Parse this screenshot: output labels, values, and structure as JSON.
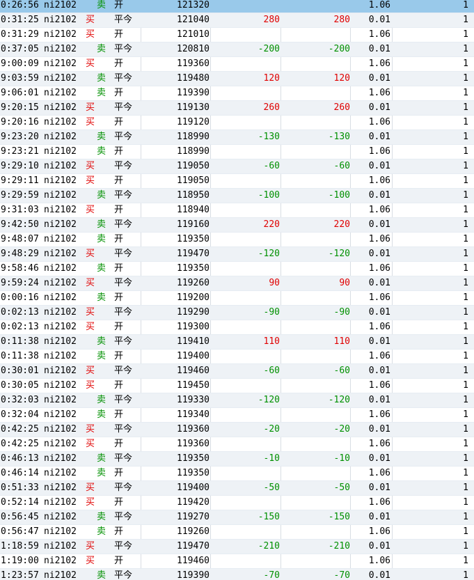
{
  "colors": {
    "buy": "#e00000",
    "sell": "#009000",
    "profit": "#e00000",
    "loss": "#009000",
    "selected_row": "#99c9ea"
  },
  "rows": [
    {
      "time": "0:26:56",
      "code": "ni2102",
      "dir": "卖",
      "oc": "开",
      "price": "121320",
      "pnl1": "",
      "pnl2": "",
      "fee": "1.06",
      "qty": "1"
    },
    {
      "time": "0:31:25",
      "code": "ni2102",
      "dir": "买",
      "oc": "平今",
      "price": "121040",
      "pnl1": "280",
      "pnl2": "280",
      "fee": "0.01",
      "qty": "1"
    },
    {
      "time": "0:31:29",
      "code": "ni2102",
      "dir": "买",
      "oc": "开",
      "price": "121010",
      "pnl1": "",
      "pnl2": "",
      "fee": "1.06",
      "qty": "1"
    },
    {
      "time": "0:37:05",
      "code": "ni2102",
      "dir": "卖",
      "oc": "平今",
      "price": "120810",
      "pnl1": "-200",
      "pnl2": "-200",
      "fee": "0.01",
      "qty": "1"
    },
    {
      "time": "9:00:09",
      "code": "ni2102",
      "dir": "买",
      "oc": "开",
      "price": "119360",
      "pnl1": "",
      "pnl2": "",
      "fee": "1.06",
      "qty": "1"
    },
    {
      "time": "9:03:59",
      "code": "ni2102",
      "dir": "卖",
      "oc": "平今",
      "price": "119480",
      "pnl1": "120",
      "pnl2": "120",
      "fee": "0.01",
      "qty": "1"
    },
    {
      "time": "9:06:01",
      "code": "ni2102",
      "dir": "卖",
      "oc": "开",
      "price": "119390",
      "pnl1": "",
      "pnl2": "",
      "fee": "1.06",
      "qty": "1"
    },
    {
      "time": "9:20:15",
      "code": "ni2102",
      "dir": "买",
      "oc": "平今",
      "price": "119130",
      "pnl1": "260",
      "pnl2": "260",
      "fee": "0.01",
      "qty": "1"
    },
    {
      "time": "9:20:16",
      "code": "ni2102",
      "dir": "买",
      "oc": "开",
      "price": "119120",
      "pnl1": "",
      "pnl2": "",
      "fee": "1.06",
      "qty": "1"
    },
    {
      "time": "9:23:20",
      "code": "ni2102",
      "dir": "卖",
      "oc": "平今",
      "price": "118990",
      "pnl1": "-130",
      "pnl2": "-130",
      "fee": "0.01",
      "qty": "1"
    },
    {
      "time": "9:23:21",
      "code": "ni2102",
      "dir": "卖",
      "oc": "开",
      "price": "118990",
      "pnl1": "",
      "pnl2": "",
      "fee": "1.06",
      "qty": "1"
    },
    {
      "time": "9:29:10",
      "code": "ni2102",
      "dir": "买",
      "oc": "平今",
      "price": "119050",
      "pnl1": "-60",
      "pnl2": "-60",
      "fee": "0.01",
      "qty": "1"
    },
    {
      "time": "9:29:11",
      "code": "ni2102",
      "dir": "买",
      "oc": "开",
      "price": "119050",
      "pnl1": "",
      "pnl2": "",
      "fee": "1.06",
      "qty": "1"
    },
    {
      "time": "9:29:59",
      "code": "ni2102",
      "dir": "卖",
      "oc": "平今",
      "price": "118950",
      "pnl1": "-100",
      "pnl2": "-100",
      "fee": "0.01",
      "qty": "1"
    },
    {
      "time": "9:31:03",
      "code": "ni2102",
      "dir": "买",
      "oc": "开",
      "price": "118940",
      "pnl1": "",
      "pnl2": "",
      "fee": "1.06",
      "qty": "1"
    },
    {
      "time": "9:42:50",
      "code": "ni2102",
      "dir": "卖",
      "oc": "平今",
      "price": "119160",
      "pnl1": "220",
      "pnl2": "220",
      "fee": "0.01",
      "qty": "1"
    },
    {
      "time": "9:48:07",
      "code": "ni2102",
      "dir": "卖",
      "oc": "开",
      "price": "119350",
      "pnl1": "",
      "pnl2": "",
      "fee": "1.06",
      "qty": "1"
    },
    {
      "time": "9:48:29",
      "code": "ni2102",
      "dir": "买",
      "oc": "平今",
      "price": "119470",
      "pnl1": "-120",
      "pnl2": "-120",
      "fee": "0.01",
      "qty": "1"
    },
    {
      "time": "9:58:46",
      "code": "ni2102",
      "dir": "卖",
      "oc": "开",
      "price": "119350",
      "pnl1": "",
      "pnl2": "",
      "fee": "1.06",
      "qty": "1"
    },
    {
      "time": "9:59:24",
      "code": "ni2102",
      "dir": "买",
      "oc": "平今",
      "price": "119260",
      "pnl1": "90",
      "pnl2": "90",
      "fee": "0.01",
      "qty": "1"
    },
    {
      "time": "0:00:16",
      "code": "ni2102",
      "dir": "卖",
      "oc": "开",
      "price": "119200",
      "pnl1": "",
      "pnl2": "",
      "fee": "1.06",
      "qty": "1"
    },
    {
      "time": "0:02:13",
      "code": "ni2102",
      "dir": "买",
      "oc": "平今",
      "price": "119290",
      "pnl1": "-90",
      "pnl2": "-90",
      "fee": "0.01",
      "qty": "1"
    },
    {
      "time": "0:02:13",
      "code": "ni2102",
      "dir": "买",
      "oc": "开",
      "price": "119300",
      "pnl1": "",
      "pnl2": "",
      "fee": "1.06",
      "qty": "1"
    },
    {
      "time": "0:11:38",
      "code": "ni2102",
      "dir": "卖",
      "oc": "平今",
      "price": "119410",
      "pnl1": "110",
      "pnl2": "110",
      "fee": "0.01",
      "qty": "1"
    },
    {
      "time": "0:11:38",
      "code": "ni2102",
      "dir": "卖",
      "oc": "开",
      "price": "119400",
      "pnl1": "",
      "pnl2": "",
      "fee": "1.06",
      "qty": "1"
    },
    {
      "time": "0:30:01",
      "code": "ni2102",
      "dir": "买",
      "oc": "平今",
      "price": "119460",
      "pnl1": "-60",
      "pnl2": "-60",
      "fee": "0.01",
      "qty": "1"
    },
    {
      "time": "0:30:05",
      "code": "ni2102",
      "dir": "买",
      "oc": "开",
      "price": "119450",
      "pnl1": "",
      "pnl2": "",
      "fee": "1.06",
      "qty": "1"
    },
    {
      "time": "0:32:03",
      "code": "ni2102",
      "dir": "卖",
      "oc": "平今",
      "price": "119330",
      "pnl1": "-120",
      "pnl2": "-120",
      "fee": "0.01",
      "qty": "1"
    },
    {
      "time": "0:32:04",
      "code": "ni2102",
      "dir": "卖",
      "oc": "开",
      "price": "119340",
      "pnl1": "",
      "pnl2": "",
      "fee": "1.06",
      "qty": "1"
    },
    {
      "time": "0:42:25",
      "code": "ni2102",
      "dir": "买",
      "oc": "平今",
      "price": "119360",
      "pnl1": "-20",
      "pnl2": "-20",
      "fee": "0.01",
      "qty": "1"
    },
    {
      "time": "0:42:25",
      "code": "ni2102",
      "dir": "买",
      "oc": "开",
      "price": "119360",
      "pnl1": "",
      "pnl2": "",
      "fee": "1.06",
      "qty": "1"
    },
    {
      "time": "0:46:13",
      "code": "ni2102",
      "dir": "卖",
      "oc": "平今",
      "price": "119350",
      "pnl1": "-10",
      "pnl2": "-10",
      "fee": "0.01",
      "qty": "1"
    },
    {
      "time": "0:46:14",
      "code": "ni2102",
      "dir": "卖",
      "oc": "开",
      "price": "119350",
      "pnl1": "",
      "pnl2": "",
      "fee": "1.06",
      "qty": "1"
    },
    {
      "time": "0:51:33",
      "code": "ni2102",
      "dir": "买",
      "oc": "平今",
      "price": "119400",
      "pnl1": "-50",
      "pnl2": "-50",
      "fee": "0.01",
      "qty": "1"
    },
    {
      "time": "0:52:14",
      "code": "ni2102",
      "dir": "买",
      "oc": "开",
      "price": "119420",
      "pnl1": "",
      "pnl2": "",
      "fee": "1.06",
      "qty": "1"
    },
    {
      "time": "0:56:45",
      "code": "ni2102",
      "dir": "卖",
      "oc": "平今",
      "price": "119270",
      "pnl1": "-150",
      "pnl2": "-150",
      "fee": "0.01",
      "qty": "1"
    },
    {
      "time": "0:56:47",
      "code": "ni2102",
      "dir": "卖",
      "oc": "开",
      "price": "119260",
      "pnl1": "",
      "pnl2": "",
      "fee": "1.06",
      "qty": "1"
    },
    {
      "time": "1:18:59",
      "code": "ni2102",
      "dir": "买",
      "oc": "平今",
      "price": "119470",
      "pnl1": "-210",
      "pnl2": "-210",
      "fee": "0.01",
      "qty": "1"
    },
    {
      "time": "1:19:00",
      "code": "ni2102",
      "dir": "买",
      "oc": "开",
      "price": "119460",
      "pnl1": "",
      "pnl2": "",
      "fee": "1.06",
      "qty": "1"
    },
    {
      "time": "1:23:57",
      "code": "ni2102",
      "dir": "卖",
      "oc": "平今",
      "price": "119390",
      "pnl1": "-70",
      "pnl2": "-70",
      "fee": "0.01",
      "qty": "1"
    }
  ]
}
